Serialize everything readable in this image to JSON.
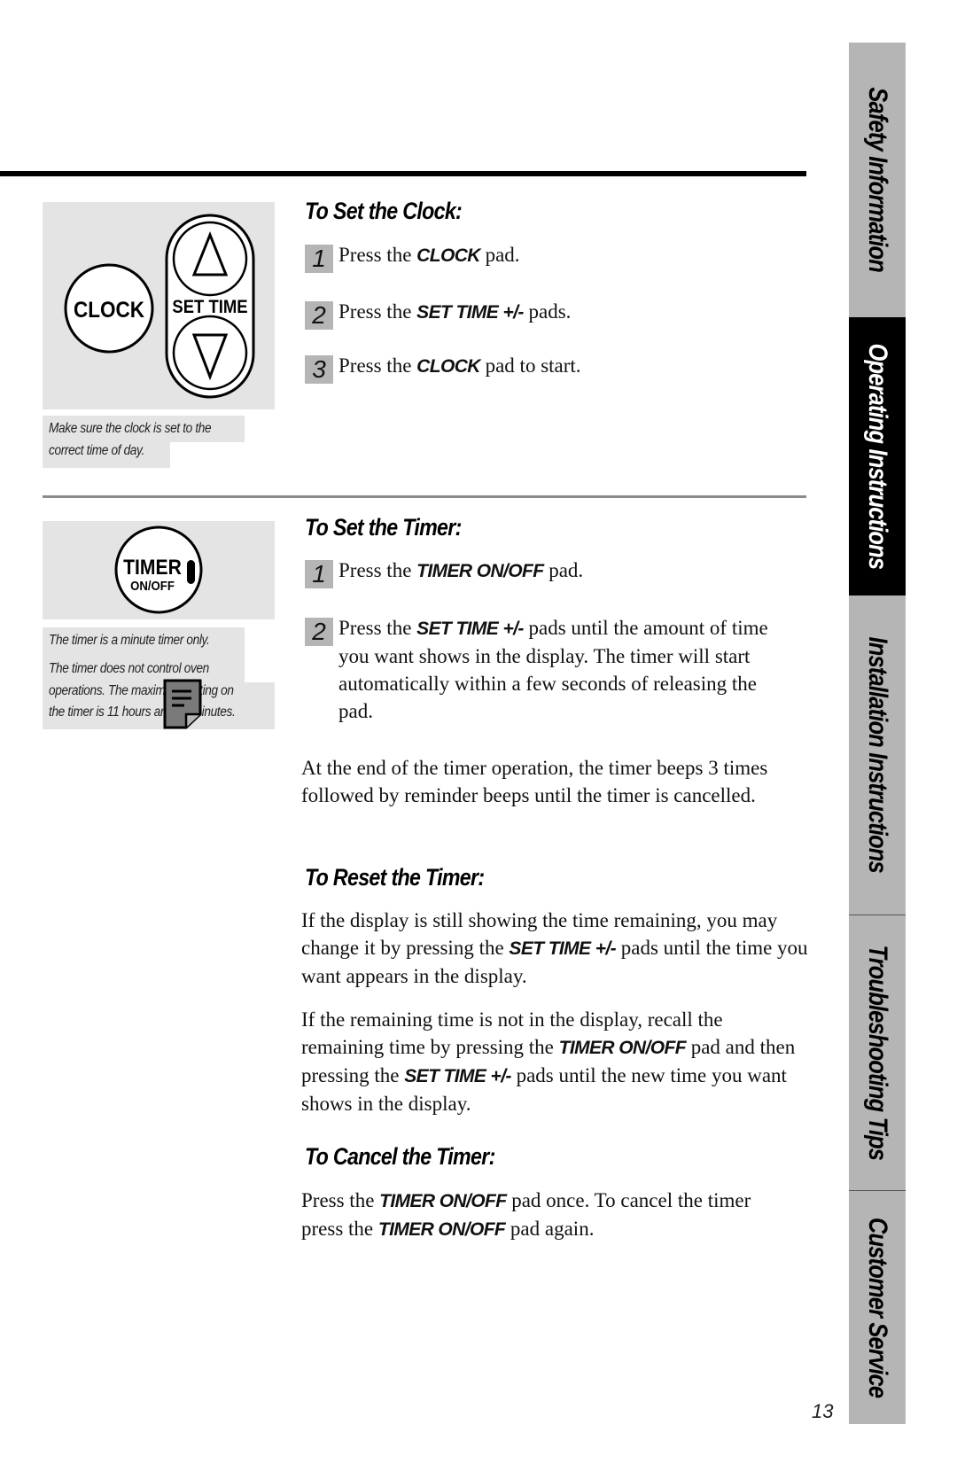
{
  "clock_section": {
    "figure": {
      "clock_button": "CLOCK",
      "set_time_label": "SET TIME"
    },
    "caption_lines": [
      "Make sure the clock is set to the",
      "correct time of day."
    ],
    "heading": "To Set the Clock:",
    "steps": [
      {
        "number": "1",
        "pre": "Press the ",
        "keyword": "CLOCK",
        "post": " pad."
      },
      {
        "number": "2",
        "pre": "Press the ",
        "keyword": "SET TIME +/-",
        "post": " pads."
      },
      {
        "number": "3",
        "pre": "Press the ",
        "keyword": "CLOCK",
        "post": " pad to start."
      }
    ]
  },
  "timer_section": {
    "figure": {
      "timer_label": "TIMER",
      "onoff_label": "ON/OFF"
    },
    "caption_lines": [
      "The timer is a minute timer only.",
      "The timer does not control oven",
      "operations. The maximum setting on",
      "the timer is 11 hours and 59 minutes."
    ],
    "heading": "To Set the Timer:",
    "steps": [
      {
        "number": "1",
        "pre": "Press the ",
        "keyword": "TIMER ON/OFF",
        "post": " pad."
      },
      {
        "number": "2",
        "pre": "Press the ",
        "keyword": "SET TIME +/-",
        "post": " pads until the amount of time you want shows in the display. The timer will start automatically within a few seconds of releasing the pad."
      }
    ],
    "end_note": "At the end of the timer operation, the timer beeps 3 times followed by reminder beeps until the timer is cancelled."
  },
  "reset_section": {
    "heading": "To Reset the Timer:",
    "para1": {
      "pre": "If the display is still showing the time remaining, you may change it by pressing the ",
      "keyword": "SET TIME +/-",
      "post": " pads until the time you want appears in the display."
    },
    "para2": {
      "pre": "If the remaining time is not in the display, recall the remaining time by pressing the ",
      "keyword1": "TIMER ON/OFF",
      "mid": " pad and then pressing the ",
      "keyword2": "SET TIME +/-",
      "post": " pads until the new time you want shows in the display."
    }
  },
  "cancel_section": {
    "heading": "To Cancel the Timer:",
    "para": {
      "pre": "Press the ",
      "keyword1": "TIMER ON/OFF",
      "mid": " pad once. To cancel the timer press the ",
      "keyword2": "TIMER ON/OFF",
      "post": " pad again."
    }
  },
  "side_tabs": [
    {
      "label": "Safety Information",
      "active": false
    },
    {
      "label": "Operating Instructions",
      "active": true
    },
    {
      "label": "Installation Instructions",
      "active": false
    },
    {
      "label": "Troubleshooting Tips",
      "active": false
    },
    {
      "label": "Customer Service",
      "active": false
    }
  ],
  "page_number": "13",
  "colors": {
    "tab_bg": "#b5b5b5",
    "tab_active": "#000000",
    "figure_bg": "#e4e4e4"
  }
}
